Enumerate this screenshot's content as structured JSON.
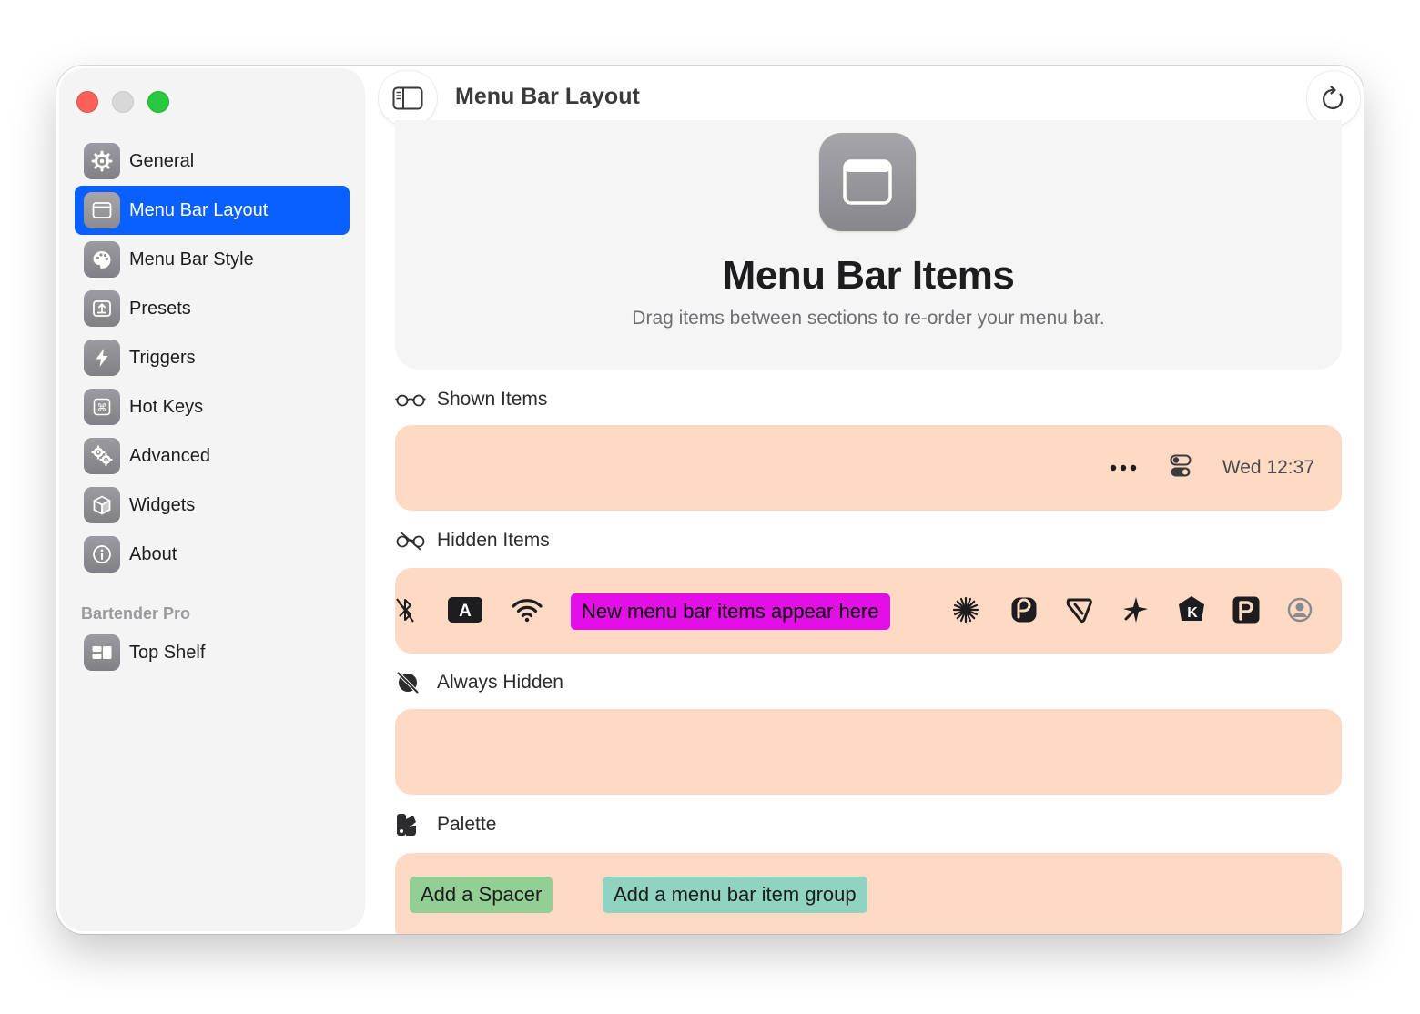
{
  "window": {
    "title": "Menu Bar Layout"
  },
  "sidebar": {
    "items": [
      {
        "id": "general",
        "label": "General",
        "icon": "gear-icon"
      },
      {
        "id": "menu-bar-layout",
        "label": "Menu Bar Layout",
        "icon": "menubar-window-icon",
        "active": true
      },
      {
        "id": "menu-bar-style",
        "label": "Menu Bar Style",
        "icon": "palette-icon"
      },
      {
        "id": "presets",
        "label": "Presets",
        "icon": "upload-tray-icon"
      },
      {
        "id": "triggers",
        "label": "Triggers",
        "icon": "bolt-icon"
      },
      {
        "id": "hot-keys",
        "label": "Hot Keys",
        "icon": "command-key-icon"
      },
      {
        "id": "advanced",
        "label": "Advanced",
        "icon": "gears-icon"
      },
      {
        "id": "widgets",
        "label": "Widgets",
        "icon": "cube-icon"
      },
      {
        "id": "about",
        "label": "About",
        "icon": "info-icon"
      }
    ],
    "section_header": "Bartender Pro",
    "pro_items": [
      {
        "id": "top-shelf",
        "label": "Top Shelf",
        "icon": "top-shelf-icon"
      }
    ]
  },
  "hero": {
    "title": "Menu Bar Items",
    "subtitle": "Drag items between sections to re-order your menu bar."
  },
  "sections": {
    "shown": {
      "label": "Shown Items",
      "icon": "glasses-icon",
      "clock": "Wed 12:37",
      "items": [
        "more-dots-icon",
        "control-center-icon"
      ]
    },
    "hidden": {
      "label": "Hidden Items",
      "icon": "glasses-slash-icon",
      "new_items_label": "New menu bar items appear here",
      "items_before": [
        "bluetooth-icon",
        "input-source-icon",
        "wifi-icon"
      ],
      "items_after": [
        "asterisk-burst-icon",
        "refresh-p-icon",
        "tag-icon",
        "plane-icon",
        "k-badge-icon",
        "p-square-icon",
        "user-circle-icon"
      ],
      "input_source_letter": "A"
    },
    "always_hidden": {
      "label": "Always Hidden",
      "icon": "eye-slash-icon"
    },
    "palette": {
      "label": "Palette",
      "icon": "palette-swatch-icon",
      "add_spacer": "Add a Spacer",
      "add_group": "Add a menu bar item group"
    }
  },
  "colors": {
    "accent": "#0a60ff",
    "zone": "#fed9c4",
    "new_items_badge": "#e40fe6",
    "spacer_chip": "#93cf95",
    "group_chip": "#8fd3c0",
    "traffic_close": "#fe5f57",
    "traffic_min": "#d8d8d8",
    "traffic_max": "#28c840"
  }
}
